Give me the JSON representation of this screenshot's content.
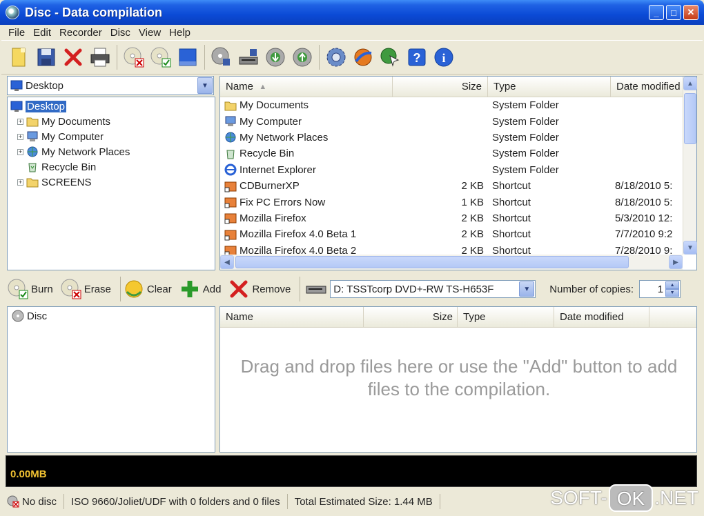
{
  "window": {
    "title": "Disc - Data compilation",
    "buttons": [
      "_",
      "□",
      "✕"
    ]
  },
  "menu": [
    "File",
    "Edit",
    "Recorder",
    "Disc",
    "View",
    "Help"
  ],
  "toolbar": [
    "new-compilation",
    "save",
    "delete",
    "print",
    "erase-disc",
    "burn-disc",
    "select-all",
    "disc-info",
    "drive-properties",
    "rip-audio",
    "write-image",
    "settings",
    "web-update",
    "cursor-help",
    "help",
    "about"
  ],
  "browser": {
    "location": "Desktop",
    "tree": [
      {
        "label": "Desktop",
        "selected": true
      },
      {
        "label": "My Documents"
      },
      {
        "label": "My Computer"
      },
      {
        "label": "My Network Places"
      },
      {
        "label": "Recycle Bin"
      },
      {
        "label": "SCREENS"
      }
    ],
    "columns": {
      "name": "Name",
      "size": "Size",
      "type": "Type",
      "date": "Date modified"
    },
    "rows": [
      {
        "name": "My Documents",
        "size": "",
        "type": "System Folder",
        "date": ""
      },
      {
        "name": "My Computer",
        "size": "",
        "type": "System Folder",
        "date": ""
      },
      {
        "name": "My Network Places",
        "size": "",
        "type": "System Folder",
        "date": ""
      },
      {
        "name": "Recycle Bin",
        "size": "",
        "type": "System Folder",
        "date": ""
      },
      {
        "name": "Internet Explorer",
        "size": "",
        "type": "System Folder",
        "date": ""
      },
      {
        "name": "CDBurnerXP",
        "size": "2 KB",
        "type": "Shortcut",
        "date": "8/18/2010 5:"
      },
      {
        "name": "Fix PC Errors  Now",
        "size": "1 KB",
        "type": "Shortcut",
        "date": "8/18/2010 5:"
      },
      {
        "name": "Mozilla Firefox",
        "size": "2 KB",
        "type": "Shortcut",
        "date": "5/3/2010 12:"
      },
      {
        "name": "Mozilla Firefox 4.0 Beta 1",
        "size": "2 KB",
        "type": "Shortcut",
        "date": "7/7/2010 9:2"
      },
      {
        "name": "Mozilla Firefox 4.0 Beta 2",
        "size": "2 KB",
        "type": "Shortcut",
        "date": "7/28/2010 9:"
      }
    ]
  },
  "actions": {
    "burn": "Burn",
    "erase": "Erase",
    "clear": "Clear",
    "add": "Add",
    "remove": "Remove",
    "drive": "D: TSSTcorp DVD+-RW TS-H653F",
    "copies_label": "Number of copies:",
    "copies_value": "1"
  },
  "compilation": {
    "root": "Disc",
    "columns": {
      "name": "Name",
      "size": "Size",
      "type": "Type",
      "date": "Date modified"
    },
    "hint": "Drag and drop files here or use the \"Add\" button to add files to the compilation."
  },
  "capacity": {
    "used": "0.00MB"
  },
  "status": {
    "disc": "No disc",
    "fs": "ISO 9660/Joliet/UDF with 0 folders and 0 files",
    "total": "Total Estimated Size: 1.44 MB"
  },
  "watermark": {
    "left": "SOFT-",
    "mid": "OK",
    "right": ".NET"
  }
}
